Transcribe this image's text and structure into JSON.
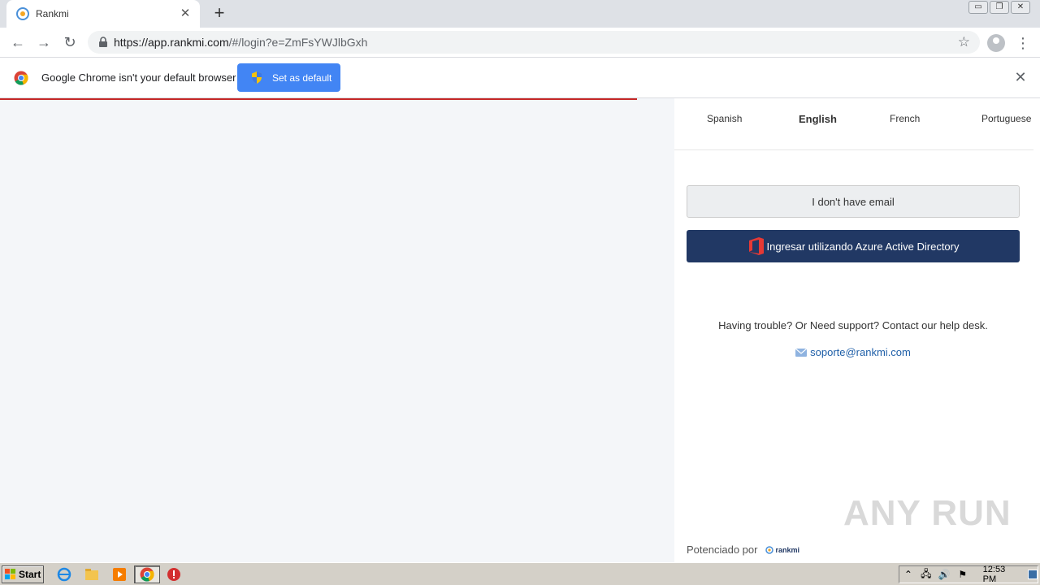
{
  "browser": {
    "tab_title": "Rankmi",
    "tab_close": "✕",
    "new_tab": "+",
    "url_host": "https://app.rankmi.com",
    "url_path": "/#/login?e=ZmFsYWJlbGxh",
    "window_controls": [
      "▭",
      "❐",
      "✕"
    ]
  },
  "infobar": {
    "message": "Google Chrome isn't your default browser",
    "button_label": "Set as default",
    "close": "✕"
  },
  "languages": {
    "spanish": "Spanish",
    "english": "English",
    "french": "French",
    "portuguese": "Portuguese",
    "active": "English"
  },
  "login": {
    "no_email_button": "I don't have email",
    "azure_button": "Ingresar utilizando Azure Active Directory",
    "support_text": "Having trouble? Or Need support? Contact our help desk.",
    "support_email": "soporte@rankmi.com",
    "powered_by": "Potenciado por",
    "logo_text": "rankmi"
  },
  "watermark": "ANY RUN",
  "taskbar": {
    "start_label": "Start",
    "clock": "12:53 PM"
  },
  "colors": {
    "azure_button": "#213864",
    "set_default_button": "#4285f4",
    "loading_bar": "#c62828",
    "page_background": "#f4f6f9"
  }
}
